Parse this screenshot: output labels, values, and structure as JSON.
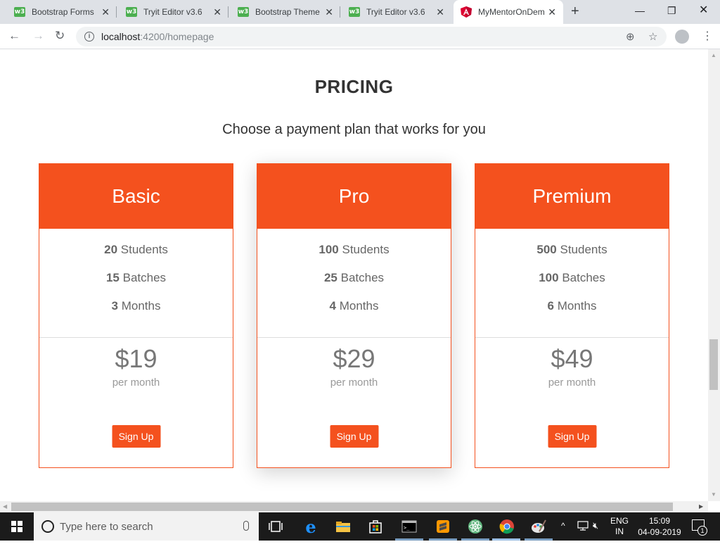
{
  "browser": {
    "tabs": [
      {
        "label": "Bootstrap Forms",
        "icon": "w3schools-icon"
      },
      {
        "label": "Tryit Editor v3.6",
        "icon": "w3schools-icon"
      },
      {
        "label": "Bootstrap Theme",
        "icon": "w3schools-icon"
      },
      {
        "label": "Tryit Editor v3.6",
        "icon": "w3schools-icon"
      },
      {
        "label": "MyMentorOnDem",
        "icon": "angular-icon",
        "active": true
      }
    ],
    "new_tab_glyph": "+",
    "close_glyph": "✕",
    "url_host": "localhost",
    "url_path": ":4200/homepage"
  },
  "page": {
    "title": "PRICING",
    "subtitle": "Choose a payment plan that works for you",
    "accent_color": "#f4511e",
    "plans": [
      {
        "name": "Basic",
        "features": [
          {
            "value": "20",
            "unit": "Students"
          },
          {
            "value": "15",
            "unit": "Batches"
          },
          {
            "value": "3",
            "unit": "Months"
          }
        ],
        "price": "$19",
        "period": "per month",
        "cta": "Sign Up"
      },
      {
        "name": "Pro",
        "features": [
          {
            "value": "100",
            "unit": "Students"
          },
          {
            "value": "25",
            "unit": "Batches"
          },
          {
            "value": "4",
            "unit": "Months"
          }
        ],
        "price": "$29",
        "period": "per month",
        "cta": "Sign Up"
      },
      {
        "name": "Premium",
        "features": [
          {
            "value": "500",
            "unit": "Students"
          },
          {
            "value": "100",
            "unit": "Batches"
          },
          {
            "value": "6",
            "unit": "Months"
          }
        ],
        "price": "$49",
        "period": "per month",
        "cta": "Sign Up"
      }
    ]
  },
  "taskbar": {
    "search_placeholder": "Type here to search",
    "lang_top": "ENG",
    "lang_bottom": "IN",
    "time": "15:09",
    "date": "04-09-2019",
    "notification_count": "1"
  }
}
